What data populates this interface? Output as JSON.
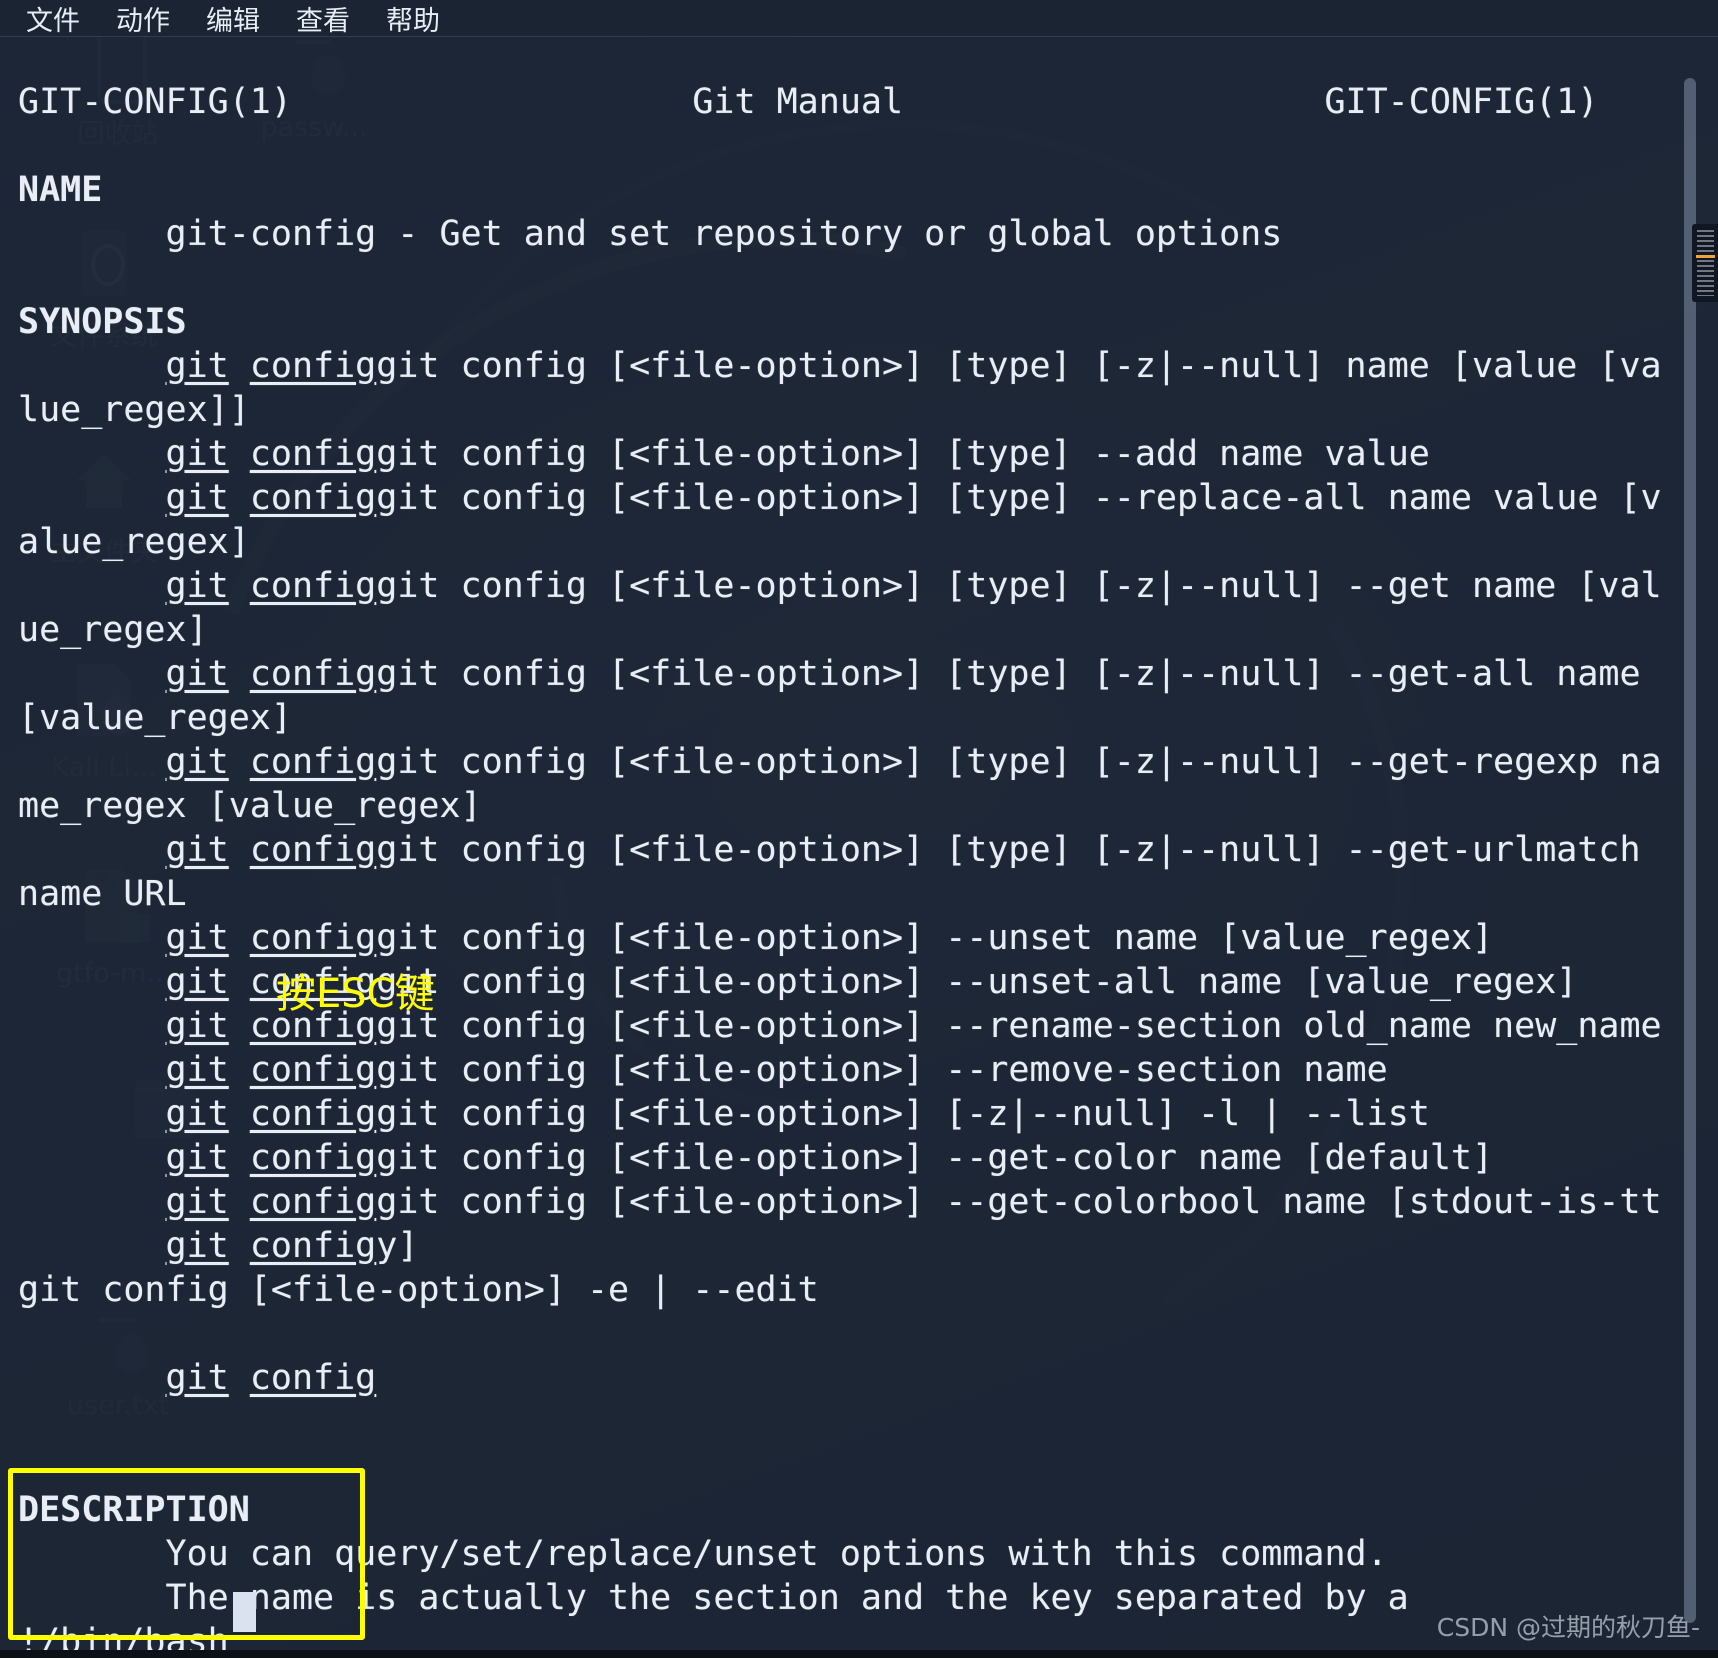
{
  "window": {
    "title": "GIT-CONFIG(1) - Git Manual",
    "background_color": "#1c2636",
    "text_color": "#e9eef6",
    "accent_color": "#ffff00"
  },
  "menubar": {
    "items": [
      {
        "label": "文件",
        "name": "menu-file"
      },
      {
        "label": "动作",
        "name": "menu-actions"
      },
      {
        "label": "编辑",
        "name": "menu-edit"
      },
      {
        "label": "查看",
        "name": "menu-view"
      },
      {
        "label": "帮助",
        "name": "menu-help"
      }
    ]
  },
  "manpage": {
    "header": {
      "left": "GIT-CONFIG(1)",
      "center": "Git Manual",
      "right": "GIT-CONFIG(1)"
    },
    "section_name_heading": "NAME",
    "name_body": "git-config - Get and set repository or global options",
    "section_synopsis_heading": "SYNOPSIS",
    "synopsis_lines": [
      "git config [<file-option>] [type] [-z|--null] name [value [va",
      "lue_regex]]",
      "git config [<file-option>] [type] --add name value",
      "git config [<file-option>] [type] --replace-all name value [v",
      "alue_regex]",
      "git config [<file-option>] [type] [-z|--null] --get name [val",
      "ue_regex]",
      "git config [<file-option>] [type] [-z|--null] --get-all name",
      "[value_regex]",
      "git config [<file-option>] [type] [-z|--null] --get-regexp na",
      "me_regex [value_regex]",
      "git config [<file-option>] [type] [-z|--null] --get-urlmatch",
      "name URL",
      "git config [<file-option>] --unset name [value_regex]",
      "git config [<file-option>] --unset-all name [value_regex]",
      "git config [<file-option>] --rename-section old_name new_name",
      "git config [<file-option>] --remove-section name",
      "git config [<file-option>] [-z|--null] -l | --list",
      "git config [<file-option>] --get-color name [default]",
      "git config [<file-option>] --get-colorbool name [stdout-is-tt",
      "y]",
      "git config [<file-option>] -e | --edit"
    ],
    "section_description_heading": "DESCRIPTION",
    "description_lines": [
      "You can query/set/replace/unset options with this command.",
      "The name is actually the section and the key separated by a"
    ],
    "prompt_line": "!/bin/bash"
  },
  "annotations": {
    "esc_hint": "按ESC键",
    "boxed_target_label": "prompt-line-highlight"
  },
  "desktop_icons": [
    {
      "label": "回收站",
      "name": "desktop-icon-recycle-bin",
      "glyph": "trash-icon"
    },
    {
      "label": "passw...",
      "name": "desktop-icon-passwd",
      "glyph": "document-lock-icon"
    },
    {
      "label": "文件系统",
      "name": "desktop-icon-filesystem",
      "glyph": "drive-icon"
    },
    {
      "label": "主文件夹",
      "name": "desktop-icon-home",
      "glyph": "home-icon"
    },
    {
      "label": "Kali Li...",
      "name": "desktop-icon-kali-linux",
      "glyph": "document-icon"
    },
    {
      "label": "gtfo-m...",
      "name": "desktop-icon-gtfo",
      "glyph": "zip-lock-icon"
    },
    {
      "label": "user.txt",
      "name": "desktop-icon-user-txt",
      "glyph": "document-lock-icon"
    }
  ],
  "scrollbar": {
    "name": "vertical-scrollbar"
  },
  "watermark": {
    "text": "CSDN @过期的秋刀鱼-"
  }
}
